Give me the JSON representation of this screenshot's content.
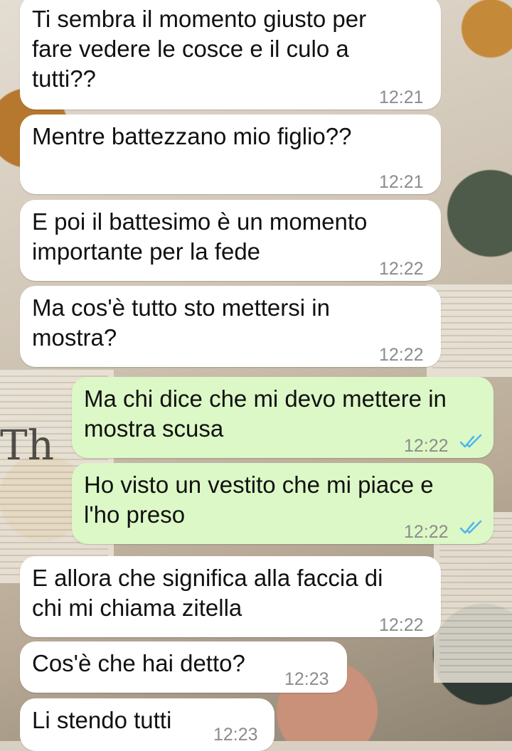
{
  "messages": [
    {
      "text": "Ti sembra il momento giusto per\nfare vedere le cosce e il culo a\ntutti??",
      "time": "12:21",
      "direction": "incoming"
    },
    {
      "text": "Mentre battezzano mio figlio??",
      "time": "12:21",
      "direction": "incoming"
    },
    {
      "text": "E poi il battesimo è un momento\nimportante per la fede",
      "time": "12:22",
      "direction": "incoming"
    },
    {
      "text": "Ma cos'è tutto sto mettersi in\nmostra?",
      "time": "12:22",
      "direction": "incoming"
    },
    {
      "text": "Ma chi dice che mi devo mettere in\nmostra scusa",
      "time": "12:22",
      "direction": "outgoing",
      "status": "read"
    },
    {
      "text": "Ho visto un vestito che mi piace e\nl'ho preso",
      "time": "12:22",
      "direction": "outgoing",
      "status": "read"
    },
    {
      "text": "E allora che significa alla faccia di\nchi mi chiama zitella",
      "time": "12:22",
      "direction": "incoming"
    },
    {
      "text": "Cos'è che hai detto?",
      "time": "12:23",
      "direction": "incoming"
    },
    {
      "text": "Li stendo tutti",
      "time": "12:23",
      "direction": "incoming"
    }
  ],
  "colors": {
    "incoming_bubble": "#ffffff",
    "outgoing_bubble": "#dcf8c6",
    "timestamp": "#8c8c8c",
    "read_ticks": "#4fb6ec"
  },
  "icons": {
    "read_receipt": "double-check-icon"
  }
}
